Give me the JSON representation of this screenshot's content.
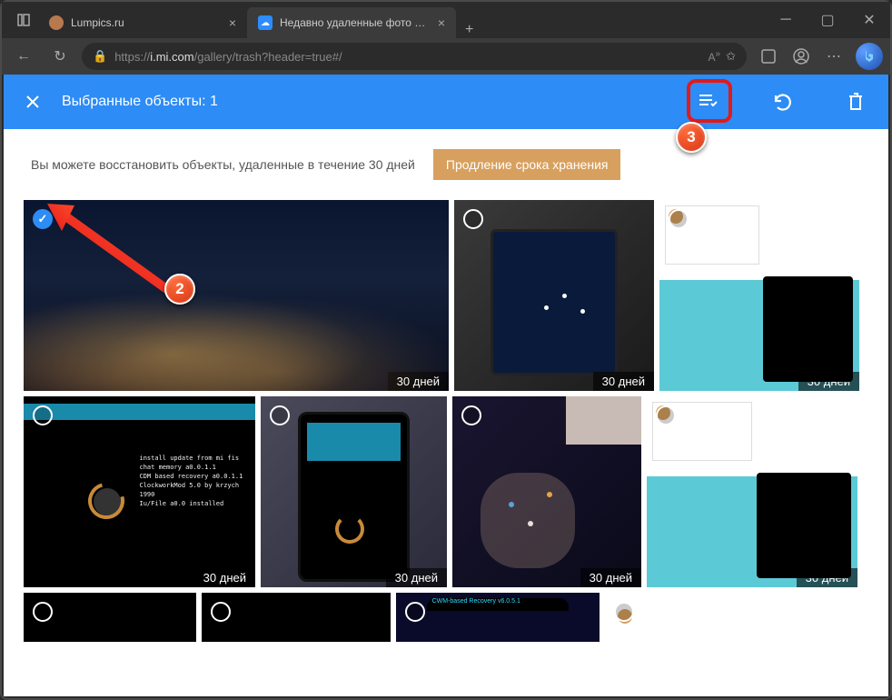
{
  "browser": {
    "tabs": [
      {
        "title": "Lumpics.ru",
        "icon": "lumpics",
        "active": false
      },
      {
        "title": "Недавно удаленные фото и вид",
        "icon": "cloud",
        "active": true
      }
    ],
    "url": "https://i.mi.com/gallery/trash?header=true#/",
    "url_host": "i.mi.com",
    "url_path": "/gallery/trash?header=true#/"
  },
  "header": {
    "title": "Выбранные объекты: 1"
  },
  "info": {
    "text": "Вы можете восстановить объекты, удаленные в течение 30 дней",
    "extend_label": "Продление срока хранения"
  },
  "photos": [
    {
      "id": 0,
      "days_label": "30 дней",
      "selected": true,
      "kind": "night-city",
      "w": "t1"
    },
    {
      "id": 1,
      "days_label": "30 дней",
      "selected": false,
      "kind": "phone-dark",
      "w": "t2"
    },
    {
      "id": 2,
      "days_label": "30 дней",
      "selected": false,
      "kind": "desktop-cyan",
      "w": "t3"
    },
    {
      "id": 3,
      "days_label": "30 дней",
      "selected": false,
      "kind": "terminal-black"
    },
    {
      "id": 4,
      "days_label": "30 дней",
      "selected": false,
      "kind": "phone-recovery"
    },
    {
      "id": 5,
      "days_label": "30 дней",
      "selected": false,
      "kind": "hand-phone"
    },
    {
      "id": 6,
      "days_label": "30 дней",
      "selected": false,
      "kind": "desktop-cyan"
    }
  ],
  "annotations": {
    "badge2": "2",
    "badge3": "3"
  }
}
